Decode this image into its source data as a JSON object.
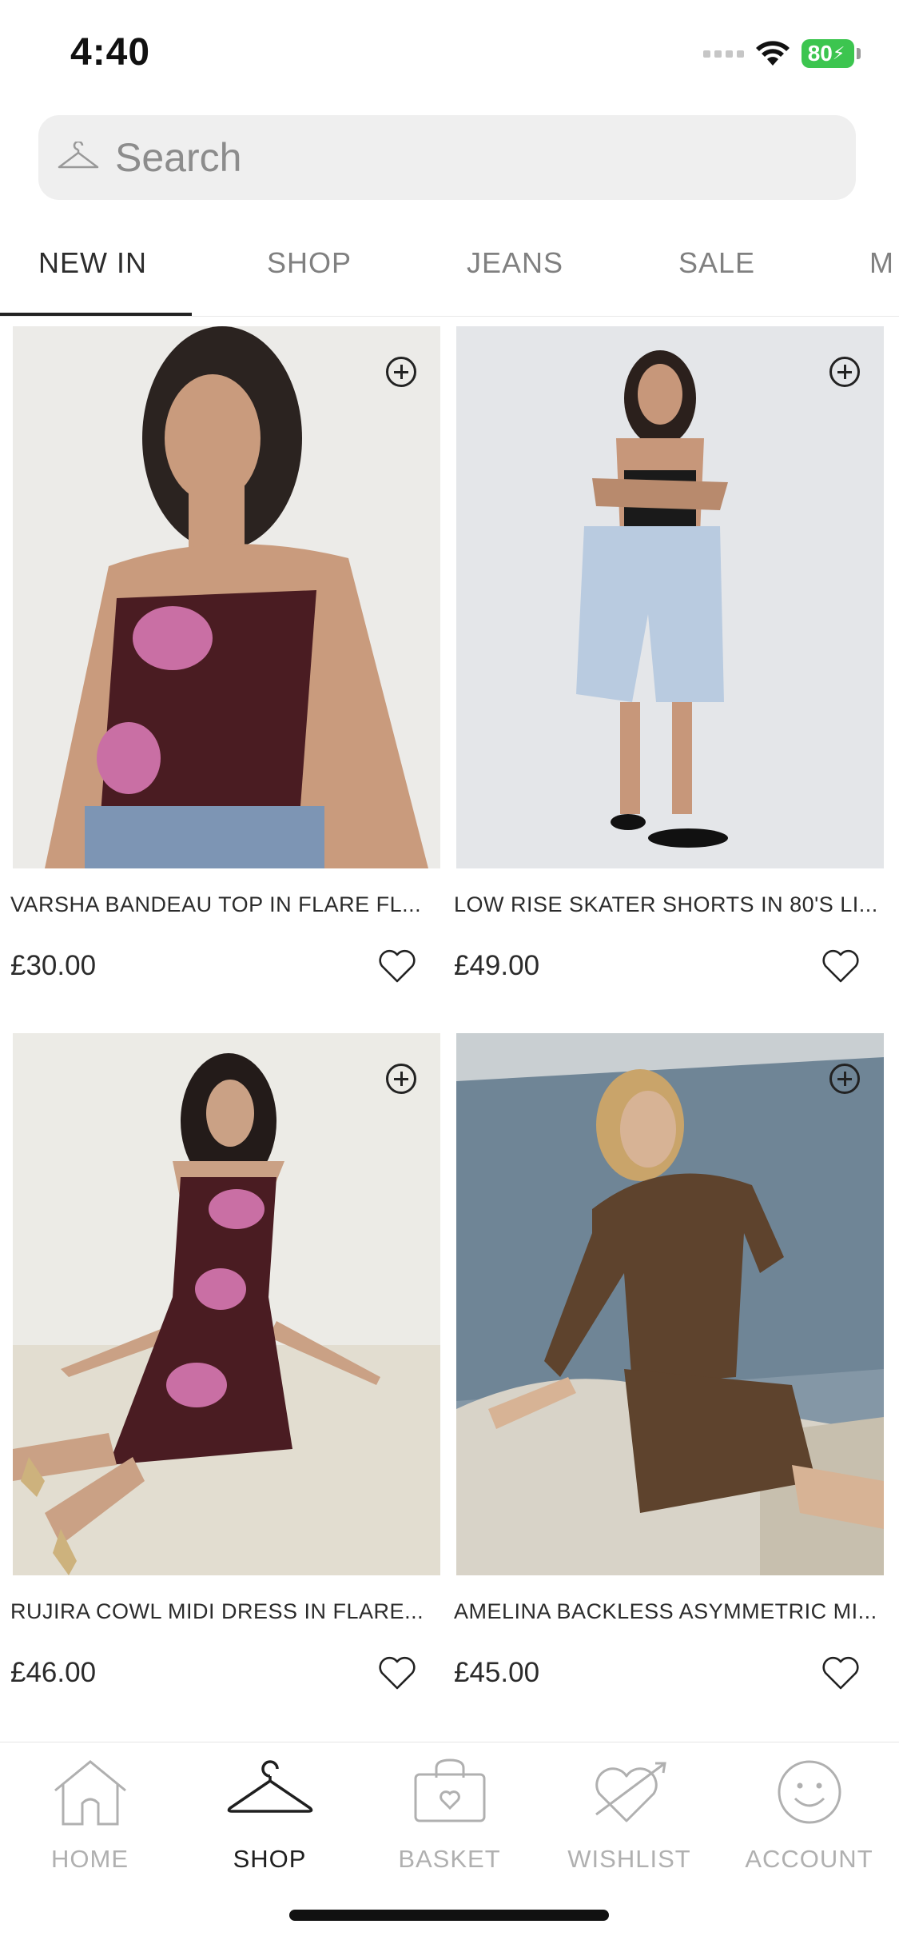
{
  "status_bar": {
    "time": "4:40",
    "battery": "80"
  },
  "search": {
    "placeholder": "Search",
    "icon": "hanger-icon"
  },
  "tabs": [
    {
      "label": "NEW IN",
      "active": true
    },
    {
      "label": "SHOP"
    },
    {
      "label": "JEANS"
    },
    {
      "label": "SALE"
    },
    {
      "label": "M"
    }
  ],
  "products": [
    {
      "name": "VARSHA BANDEAU TOP IN FLARE FL...",
      "price": "£30.00"
    },
    {
      "name": "LOW RISE SKATER SHORTS IN 80'S LI...",
      "price": "£49.00"
    },
    {
      "name": "RUJIRA COWL MIDI DRESS IN FLARE...",
      "price": "£46.00"
    },
    {
      "name": "AMELINA BACKLESS ASYMMETRIC MI...",
      "price": "£45.00"
    }
  ],
  "bottom_nav": [
    {
      "label": "HOME",
      "icon": "house-icon"
    },
    {
      "label": "SHOP",
      "icon": "hanger-icon",
      "active": true
    },
    {
      "label": "BASKET",
      "icon": "bag-icon"
    },
    {
      "label": "WISHLIST",
      "icon": "heart-arrow-icon"
    },
    {
      "label": "ACCOUNT",
      "icon": "smiley-icon"
    }
  ],
  "colors": {
    "battery_green": "#3cc54f",
    "active_text": "#2d2d2d",
    "inactive_text": "#b0b0b0"
  }
}
